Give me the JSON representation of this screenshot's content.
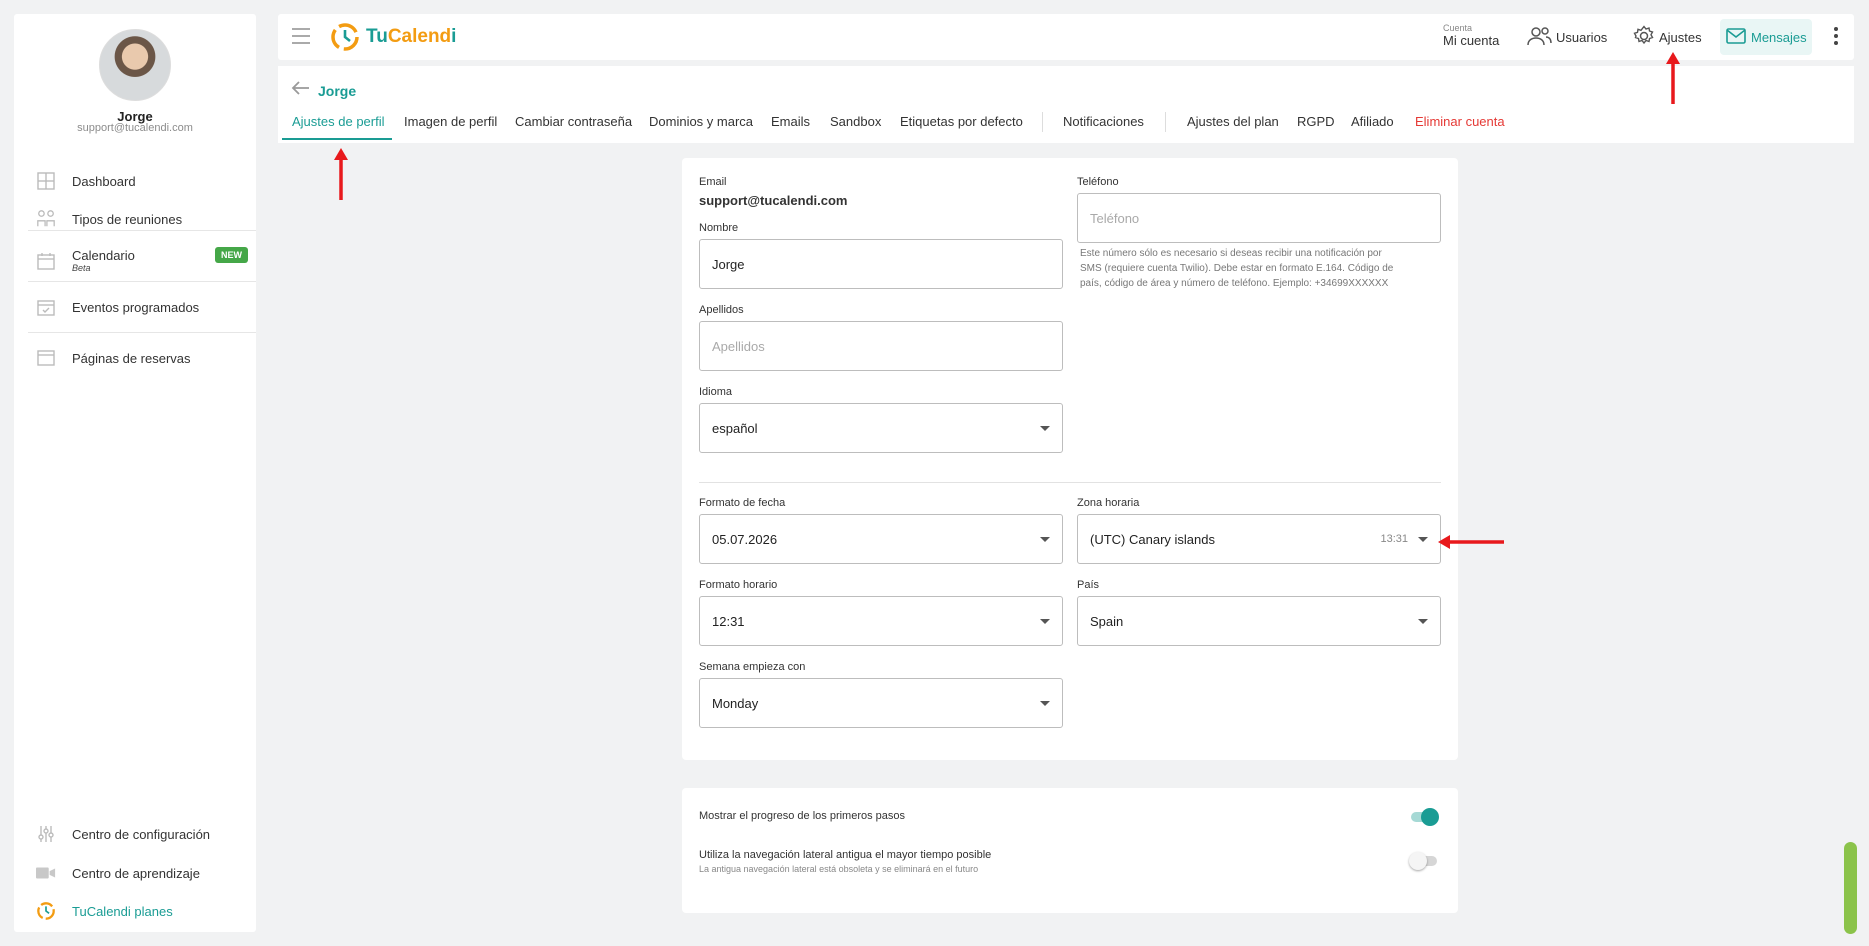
{
  "sidebar": {
    "user_name": "Jorge",
    "user_email": "support@tucalendi.com",
    "items": [
      {
        "label": "Dashboard",
        "icon": "grid-icon"
      },
      {
        "label": "Tipos de reuniones",
        "icon": "people-icon"
      },
      {
        "label": "Calendario",
        "icon": "calendar-icon",
        "sub": "Beta",
        "badge": "NEW"
      },
      {
        "label": "Eventos programados",
        "icon": "calendar-check-icon"
      },
      {
        "label": "Páginas de reservas",
        "icon": "window-icon"
      }
    ],
    "bottom_items": [
      {
        "label": "Centro de configuración",
        "icon": "sliders-icon"
      },
      {
        "label": "Centro de aprendizaje",
        "icon": "video-icon"
      },
      {
        "label": "TuCalendi planes",
        "icon": "tucalendi-logo-icon"
      }
    ]
  },
  "header": {
    "logo_tu": "Tu",
    "logo_calend": "Calend",
    "logo_i": "i",
    "account_small": "Cuenta",
    "account_label": "Mi cuenta",
    "users_label": "Usuarios",
    "settings_label": "Ajustes",
    "messages_label": "Mensajes"
  },
  "page": {
    "back_title": "Jorge",
    "tabs": [
      "Ajustes de perfil",
      "Imagen de perfil",
      "Cambiar contraseña",
      "Dominios y marca",
      "Emails",
      "Sandbox",
      "Etiquetas por defecto",
      "Notificaciones",
      "Ajustes del plan",
      "RGPD",
      "Afiliado",
      "Eliminar cuenta"
    ]
  },
  "form": {
    "email_label": "Email",
    "email_value": "support@tucalendi.com",
    "name_label": "Nombre",
    "name_value": "Jorge",
    "surname_label": "Apellidos",
    "surname_placeholder": "Apellidos",
    "language_label": "Idioma",
    "language_value": "español",
    "phone_label": "Teléfono",
    "phone_placeholder": "Teléfono",
    "phone_help_1": "Este número sólo es necesario si deseas recibir una notificación por",
    "phone_help_2": "SMS (requiere cuenta Twilio). Debe estar en formato E.164. Código de",
    "phone_help_3": "país, código de área y número de teléfono. Ejemplo: +34699XXXXXX",
    "date_format_label": "Formato de fecha",
    "date_format_value": "05.07.2026",
    "timezone_label": "Zona horaria",
    "timezone_value": "(UTC) Canary islands",
    "timezone_time": "13:31",
    "time_format_label": "Formato horario",
    "time_format_value": "12:31",
    "country_label": "País",
    "country_value": "Spain",
    "week_label": "Semana empieza con",
    "week_value": "Monday"
  },
  "toggles": {
    "progress_label": "Mostrar el progreso de los primeros pasos",
    "progress_on": true,
    "legacy_label": "Utiliza la navegación lateral antigua el mayor tiempo posible",
    "legacy_sub": "La antigua navegación lateral está obsoleta y se eliminará en el futuro",
    "legacy_on": false
  },
  "colors": {
    "accent": "#1a9c94",
    "danger": "#e53935",
    "badge": "#45a748",
    "annotation": "#e8191c"
  }
}
